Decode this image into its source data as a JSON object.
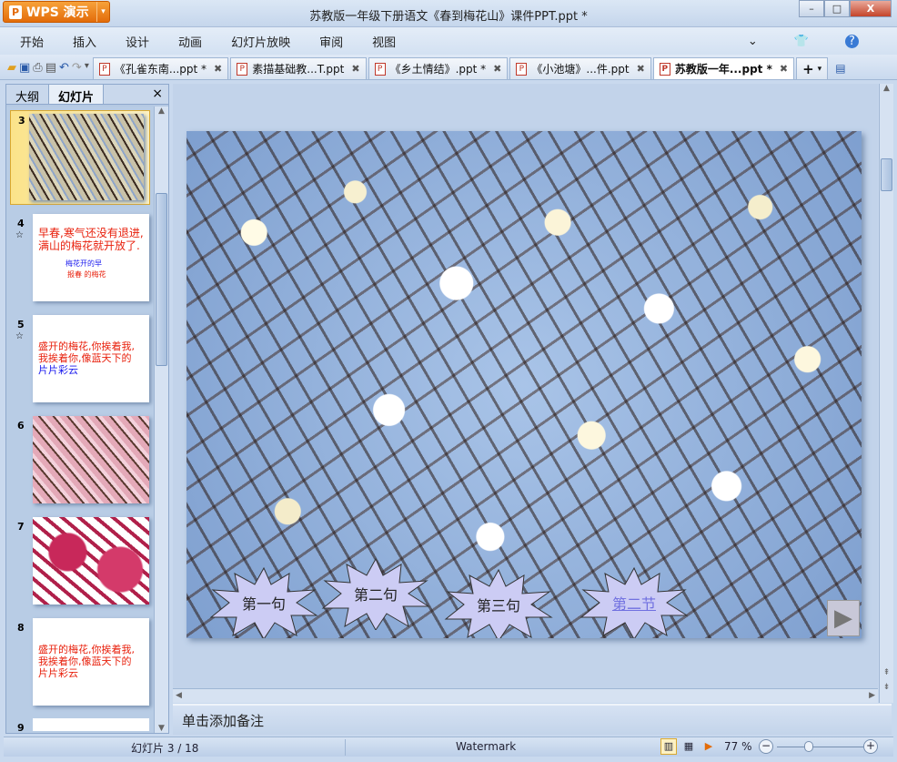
{
  "app": {
    "name": "WPS 演示",
    "window_title": "苏教版一年级下册语文《春到梅花山》课件PPT.ppt *"
  },
  "window_controls": {
    "minimize": "–",
    "maximize": "□",
    "close": "X"
  },
  "menu": [
    "开始",
    "插入",
    "设计",
    "动画",
    "幻灯片放映",
    "审阅",
    "视图"
  ],
  "doc_tabs": [
    {
      "label": "《孔雀东南...ppt *",
      "active": false
    },
    {
      "label": "素描基础教...T.ppt",
      "active": false
    },
    {
      "label": "《乡土情结》.ppt *",
      "active": false
    },
    {
      "label": "《小池塘》...件.ppt",
      "active": false
    },
    {
      "label": "苏教版一年...ppt *",
      "active": true
    }
  ],
  "panel": {
    "tabs": [
      "大纲",
      "幻灯片"
    ],
    "active_tab": "幻灯片",
    "close": "×"
  },
  "thumbnails": [
    {
      "num": "3",
      "selected": true
    },
    {
      "num": "4",
      "star": "☆",
      "lines": [
        "早春,寒气还没有退进,",
        "满山的梅花就开放了.",
        "梅花开的早",
        "报春 的梅花"
      ]
    },
    {
      "num": "5",
      "star": "☆",
      "lines": [
        "盛开的梅花,你挨着我,",
        "我挨着你,像蓝天下的",
        "片片彩云"
      ]
    },
    {
      "num": "6"
    },
    {
      "num": "7"
    },
    {
      "num": "8",
      "lines": [
        "盛开的梅花,你挨着我,",
        "我挨着你,像蓝天下的",
        "片片彩云"
      ]
    },
    {
      "num": "9"
    }
  ],
  "slide": {
    "buttons": [
      "第一句",
      "第二句",
      "第三句",
      "第二节"
    ],
    "next": "▶"
  },
  "notes_placeholder": "单击添加备注",
  "status": {
    "slide_indicator": "幻灯片 3 / 18",
    "watermark": "Watermark",
    "zoom": "77 %",
    "zoom_fraction": 0.4
  },
  "colors": {
    "accent": "#e36c0a",
    "red_text": "#e8200c",
    "blue_text": "#1a1aee"
  }
}
